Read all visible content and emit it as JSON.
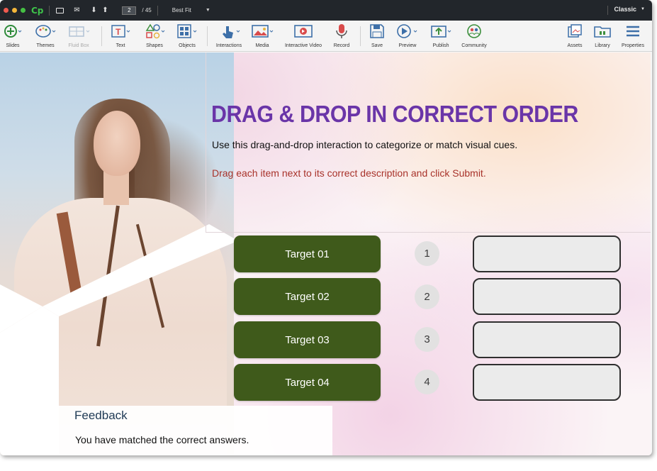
{
  "window": {
    "page_current": "2",
    "page_total": "/ 45",
    "zoom": "Best Fit",
    "workspace": "Classic"
  },
  "toolbar": {
    "items": [
      {
        "label": "Slides",
        "icon": "add-slide-icon"
      },
      {
        "label": "Themes",
        "icon": "palette-icon"
      },
      {
        "label": "Fluid Box",
        "icon": "fluid-box-icon"
      },
      {
        "label": "Text",
        "icon": "text-icon"
      },
      {
        "label": "Shapes",
        "icon": "shapes-icon"
      },
      {
        "label": "Objects",
        "icon": "objects-icon"
      },
      {
        "label": "Interactions",
        "icon": "interactions-icon"
      },
      {
        "label": "Media",
        "icon": "media-icon"
      },
      {
        "label": "Interactive Video",
        "icon": "interactive-video-icon"
      },
      {
        "label": "Record",
        "icon": "microphone-icon"
      },
      {
        "label": "Save",
        "icon": "save-icon"
      },
      {
        "label": "Preview",
        "icon": "play-icon"
      },
      {
        "label": "Publish",
        "icon": "publish-icon"
      },
      {
        "label": "Community",
        "icon": "community-icon"
      },
      {
        "label": "Assets",
        "icon": "assets-icon"
      },
      {
        "label": "Library",
        "icon": "library-icon"
      },
      {
        "label": "Properties",
        "icon": "properties-icon"
      }
    ]
  },
  "slide": {
    "title": "DRAG & DROP IN CORRECT ORDER",
    "subtitle": "Use this drag-and-drop interaction to categorize or match visual cues.",
    "instruction": "Drag each item next to its correct description and click Submit.",
    "rows": [
      {
        "target": "Target 01",
        "number": "1"
      },
      {
        "target": "Target 02",
        "number": "2"
      },
      {
        "target": "Target 03",
        "number": "3"
      },
      {
        "target": "Target 04",
        "number": "4"
      }
    ],
    "feedback": {
      "title": "Feedback",
      "text": "You have matched the correct answers."
    }
  },
  "colors": {
    "title": "#6a35a8",
    "instruction": "#a8322a",
    "target_bg": "#3f5a1b",
    "drop_bg": "#ebebeb"
  }
}
